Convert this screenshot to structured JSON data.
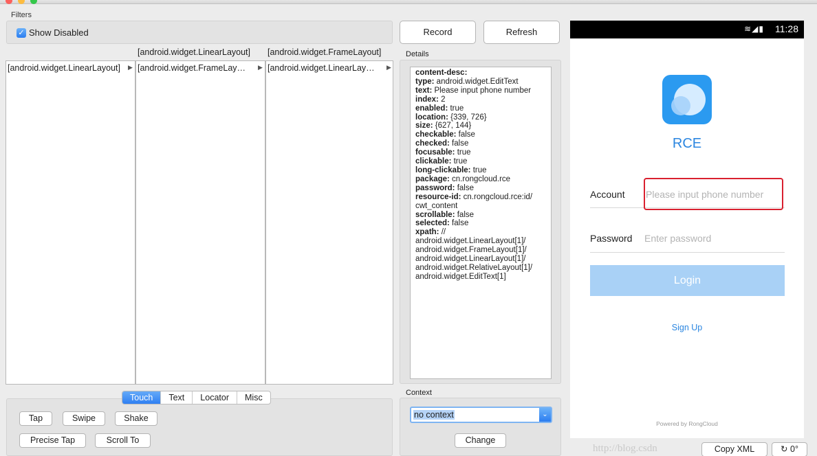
{
  "filters": {
    "label": "Filters",
    "show_disabled_label": "Show Disabled"
  },
  "browser": {
    "headers": [
      "",
      "[android.widget.LinearLayout]",
      "[android.widget.FrameLayout]"
    ],
    "columns": [
      {
        "item": "[android.widget.LinearLayout]"
      },
      {
        "item": "[android.widget.FrameLay…"
      },
      {
        "item": "[android.widget.LinearLay…"
      }
    ]
  },
  "tabs": [
    "Touch",
    "Text",
    "Locator",
    "Misc"
  ],
  "actions": {
    "tap": "Tap",
    "swipe": "Swipe",
    "shake": "Shake",
    "precise_tap": "Precise Tap",
    "scroll_to": "Scroll To"
  },
  "toolbar": {
    "record": "Record",
    "refresh": "Refresh"
  },
  "details": {
    "label": "Details",
    "lines": [
      [
        "content-desc:",
        ""
      ],
      [
        "type:",
        " android.widget.EditText"
      ],
      [
        "text:",
        " Please input phone number"
      ],
      [
        "index:",
        " 2"
      ],
      [
        "enabled:",
        " true"
      ],
      [
        "location:",
        " {339, 726}"
      ],
      [
        "size:",
        " {627, 144}"
      ],
      [
        "checkable:",
        " false"
      ],
      [
        "checked:",
        " false"
      ],
      [
        "focusable:",
        " true"
      ],
      [
        "clickable:",
        " true"
      ],
      [
        "long-clickable:",
        " true"
      ],
      [
        "package:",
        " cn.rongcloud.rce"
      ],
      [
        "password:",
        " false"
      ],
      [
        "resource-id:",
        " cn.rongcloud.rce:id/"
      ],
      [
        "",
        "cwt_content"
      ],
      [
        "scrollable:",
        " false"
      ],
      [
        "selected:",
        " false"
      ],
      [
        "xpath:",
        " //"
      ],
      [
        "",
        "android.widget.LinearLayout[1]/"
      ],
      [
        "",
        "android.widget.FrameLayout[1]/"
      ],
      [
        "",
        "android.widget.LinearLayout[1]/"
      ],
      [
        "",
        "android.widget.RelativeLayout[1]/"
      ],
      [
        "",
        "android.widget.EditText[1]"
      ]
    ]
  },
  "context": {
    "label": "Context",
    "selected": "no context",
    "change": "Change"
  },
  "device": {
    "time": "11:28",
    "app_name": "RCE",
    "account_label": "Account",
    "account_placeholder": "Please input phone number",
    "password_label": "Password",
    "password_placeholder": "Enter password",
    "login": "Login",
    "signup": "Sign Up",
    "powered_by": "Powered by RongCloud"
  },
  "bottom": {
    "copy_xml": "Copy XML",
    "rotate": "0°"
  },
  "watermark": "http://blog.csdn"
}
